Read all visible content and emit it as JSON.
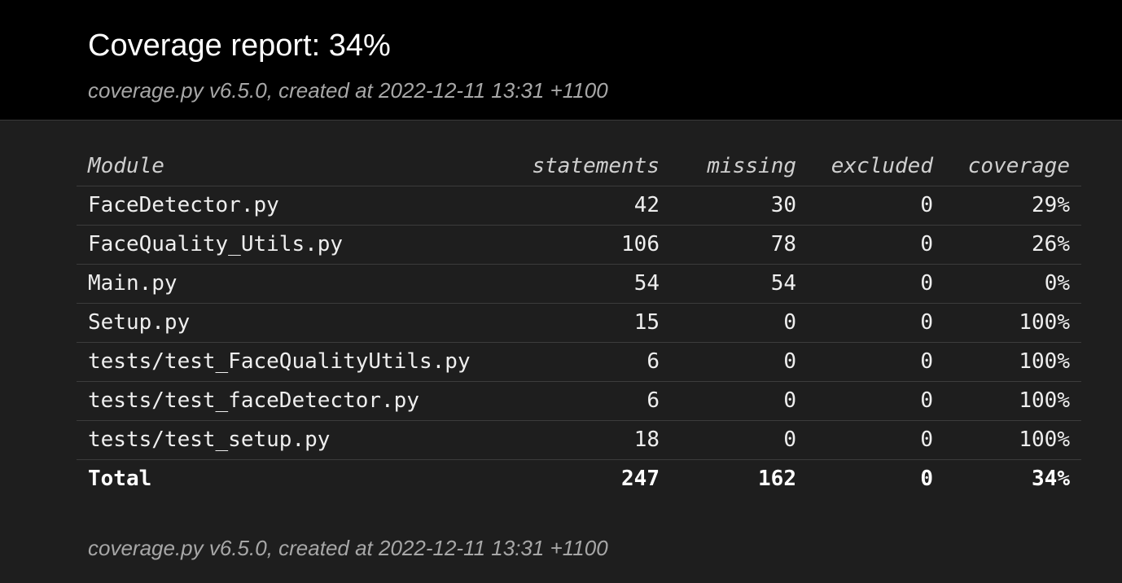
{
  "header": {
    "title": "Coverage report: 34%",
    "meta": "coverage.py v6.5.0, created at 2022-12-11 13:31 +1100"
  },
  "table": {
    "columns": [
      "Module",
      "statements",
      "missing",
      "excluded",
      "coverage"
    ],
    "rows": [
      {
        "module": "FaceDetector.py",
        "statements": "42",
        "missing": "30",
        "excluded": "0",
        "coverage": "29%"
      },
      {
        "module": "FaceQuality_Utils.py",
        "statements": "106",
        "missing": "78",
        "excluded": "0",
        "coverage": "26%"
      },
      {
        "module": "Main.py",
        "statements": "54",
        "missing": "54",
        "excluded": "0",
        "coverage": "0%"
      },
      {
        "module": "Setup.py",
        "statements": "15",
        "missing": "0",
        "excluded": "0",
        "coverage": "100%"
      },
      {
        "module": "tests/test_FaceQualityUtils.py",
        "statements": "6",
        "missing": "0",
        "excluded": "0",
        "coverage": "100%"
      },
      {
        "module": "tests/test_faceDetector.py",
        "statements": "6",
        "missing": "0",
        "excluded": "0",
        "coverage": "100%"
      },
      {
        "module": "tests/test_setup.py",
        "statements": "18",
        "missing": "0",
        "excluded": "0",
        "coverage": "100%"
      }
    ],
    "total": {
      "module": "Total",
      "statements": "247",
      "missing": "162",
      "excluded": "0",
      "coverage": "34%"
    }
  },
  "footer": {
    "meta": "coverage.py v6.5.0, created at 2022-12-11 13:31 +1100"
  },
  "colors": {
    "header_bg": "#000000",
    "page_bg": "#1e1e1e",
    "text": "#eeeeee",
    "muted": "#a7a7a7"
  }
}
